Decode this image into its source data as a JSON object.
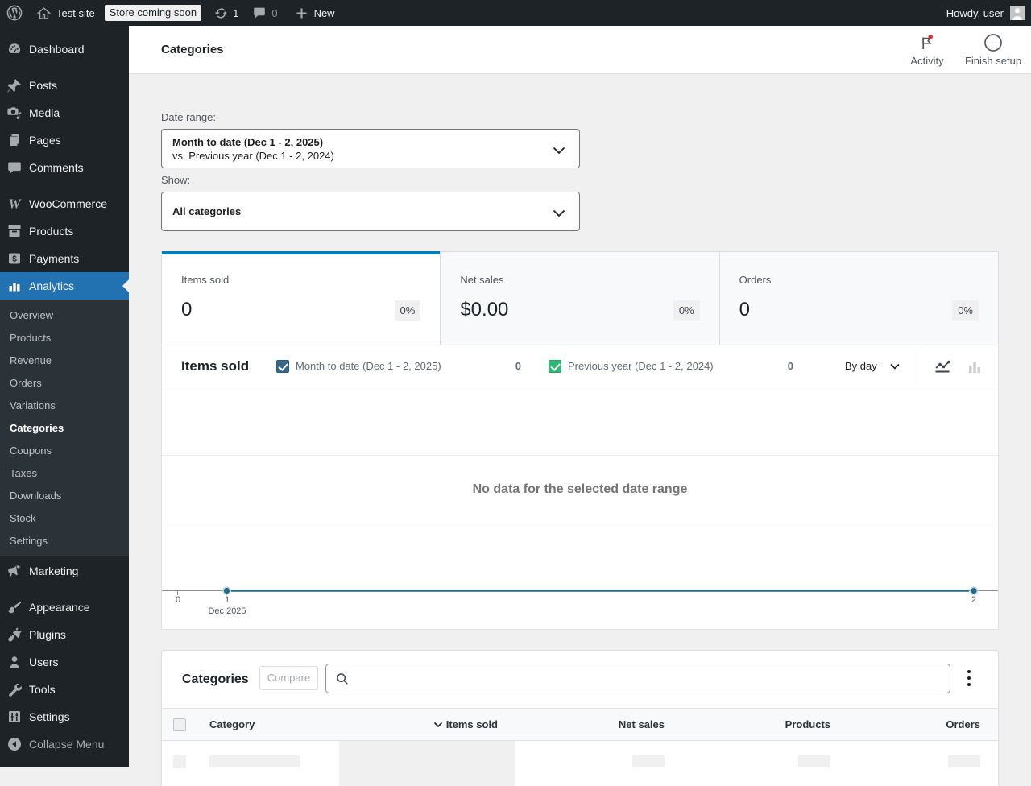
{
  "admin_bar": {
    "wp_logo": "W",
    "site_name": "Test site",
    "coming_soon_badge": "Store coming soon",
    "updates_count": "1",
    "comments_count": "0",
    "new_label": "New",
    "howdy": "Howdy, user"
  },
  "sidebar": {
    "items": [
      {
        "label": "Dashboard"
      },
      {
        "label": "Posts"
      },
      {
        "label": "Media"
      },
      {
        "label": "Pages"
      },
      {
        "label": "Comments"
      },
      {
        "label": "WooCommerce"
      },
      {
        "label": "Products"
      },
      {
        "label": "Payments"
      },
      {
        "label": "Analytics",
        "active": true
      },
      {
        "label": "Marketing"
      },
      {
        "label": "Appearance"
      },
      {
        "label": "Plugins"
      },
      {
        "label": "Users"
      },
      {
        "label": "Tools"
      },
      {
        "label": "Settings"
      }
    ],
    "analytics_submenu": [
      {
        "label": "Overview"
      },
      {
        "label": "Products"
      },
      {
        "label": "Revenue"
      },
      {
        "label": "Orders"
      },
      {
        "label": "Variations"
      },
      {
        "label": "Categories",
        "current": true
      },
      {
        "label": "Coupons"
      },
      {
        "label": "Taxes"
      },
      {
        "label": "Downloads"
      },
      {
        "label": "Stock"
      },
      {
        "label": "Settings"
      }
    ],
    "collapse_label": "Collapse Menu"
  },
  "header": {
    "title": "Categories",
    "activity_label": "Activity",
    "finish_setup_label": "Finish setup"
  },
  "filters": {
    "date_range_label": "Date range:",
    "date_range_primary": "Month to date (Dec 1 - 2, 2025)",
    "date_range_secondary": "vs. Previous year (Dec 1 - 2, 2024)",
    "show_label": "Show:",
    "show_value": "All categories"
  },
  "summary_tiles": [
    {
      "label": "Items sold",
      "value": "0",
      "delta": "0%",
      "selected": true
    },
    {
      "label": "Net sales",
      "value": "$0.00",
      "delta": "0%"
    },
    {
      "label": "Orders",
      "value": "0",
      "delta": "0%"
    }
  ],
  "chart": {
    "title": "Items sold",
    "legend": [
      {
        "label": "Month to date (Dec 1 - 2, 2025)",
        "value": "0",
        "color": "#31688c"
      },
      {
        "label": "Previous year (Dec 1 - 2, 2024)",
        "value": "0",
        "color": "#2fb874"
      }
    ],
    "interval_label": "By day",
    "empty_message": "No data for the selected date range",
    "x_tick_0": "0",
    "x_tick_1": "1",
    "x_tick_2": "2",
    "x_sublabel": "Dec 2025"
  },
  "chart_data": {
    "type": "line",
    "title": "Items sold",
    "x": [
      0,
      1,
      2
    ],
    "x_axis_note": "Dec 2025",
    "series": [
      {
        "name": "Month to date (Dec 1 - 2, 2025)",
        "values": [
          null,
          0,
          0
        ],
        "color": "#31688c"
      },
      {
        "name": "Previous year (Dec 1 - 2, 2024)",
        "values": [
          null,
          0,
          0
        ],
        "color": "#2fb874"
      }
    ],
    "ylim": [
      0,
      3
    ],
    "empty_message": "No data for the selected date range"
  },
  "table": {
    "title": "Categories",
    "compare_label": "Compare",
    "search_placeholder": "",
    "columns": [
      {
        "label": "Category"
      },
      {
        "label": "Items sold",
        "sorted": "desc"
      },
      {
        "label": "Net sales"
      },
      {
        "label": "Products"
      },
      {
        "label": "Orders"
      }
    ]
  },
  "colors": {
    "admin_accent": "#2271b1",
    "tile_accent": "#007cba",
    "series_1": "#31688c",
    "series_2": "#2fb874",
    "activity_dot": "#d63638"
  }
}
